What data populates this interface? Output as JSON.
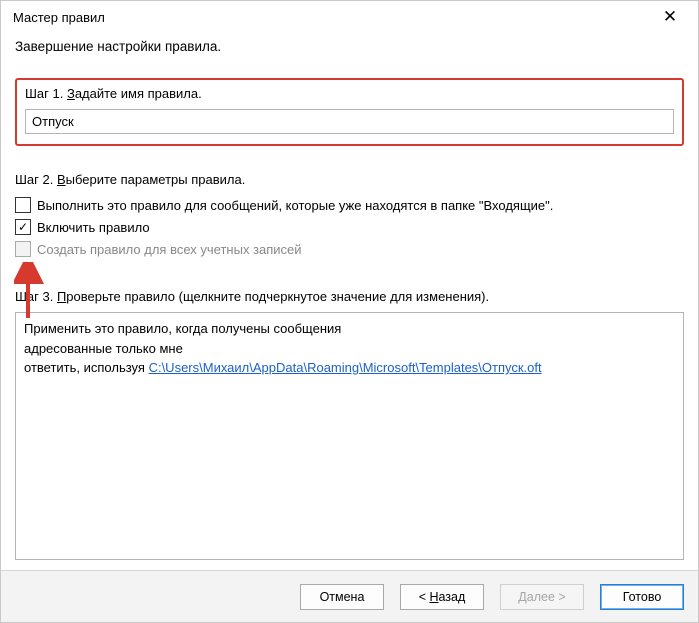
{
  "titlebar": {
    "title": "Мастер правил",
    "close_glyph": "✕"
  },
  "subtitle": "Завершение настройки правила.",
  "step1": {
    "label_before": "Шаг 1. ",
    "label_underline": "З",
    "label_after": "адайте имя правила.",
    "input_value": "Отпуск"
  },
  "step2": {
    "label_before": "Шаг 2. ",
    "label_underline": "В",
    "label_after": "ыберите параметры правила.",
    "options": [
      {
        "checked": false,
        "label": "Выполнить это правило для сообщений, которые уже находятся в папке \"Входящие\".",
        "enabled": true
      },
      {
        "checked": true,
        "label": "Включить правило",
        "enabled": true
      },
      {
        "checked": false,
        "label": "Создать правило для всех учетных записей",
        "enabled": false
      }
    ]
  },
  "step3": {
    "label_before": "Шаг 3. ",
    "label_underline": "П",
    "label_after": "роверьте правило (щелкните подчеркнутое значение для изменения).",
    "desc_line1": "Применить это правило, когда получены сообщения",
    "desc_line2": "адресованные только мне",
    "desc_line3_prefix": "ответить, используя ",
    "desc_link": "C:\\Users\\Михаил\\AppData\\Roaming\\Microsoft\\Templates\\Отпуск.oft"
  },
  "footer": {
    "cancel": "Отмена",
    "back": "< Назад",
    "next": "Далее >",
    "finish": "Готово"
  },
  "check_glyph": "✓"
}
